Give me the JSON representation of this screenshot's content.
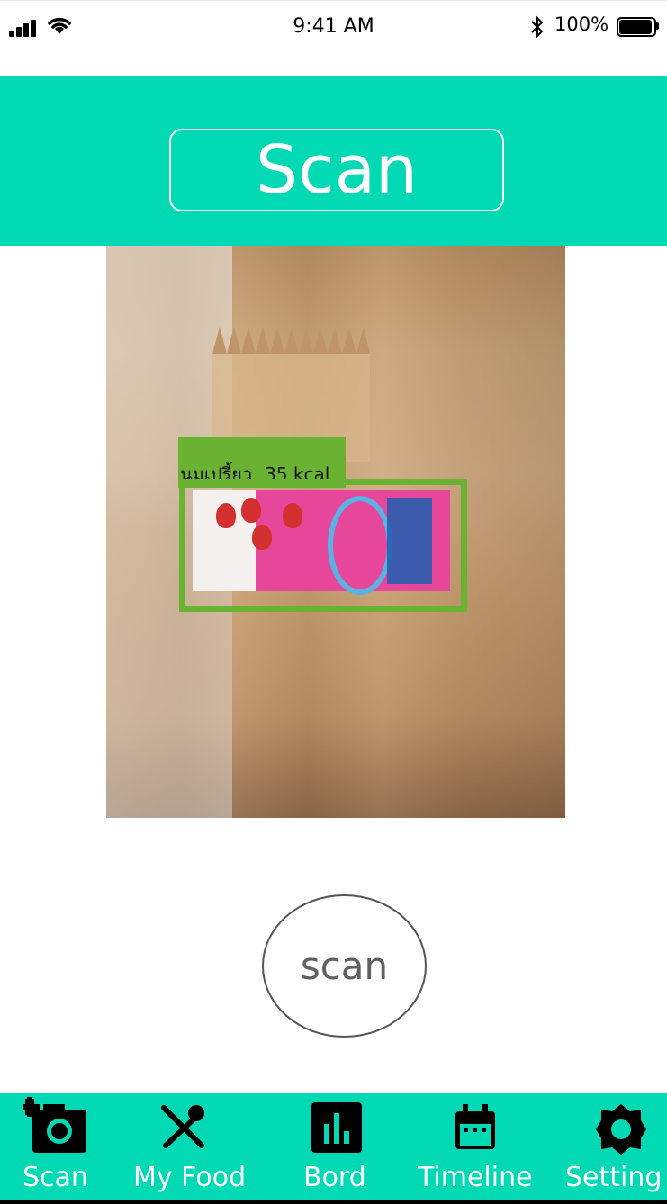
{
  "status_bar": {
    "time": "9:41 AM",
    "battery_percent": "100%",
    "battery_level": 1.0
  },
  "header": {
    "title": "Scan"
  },
  "detection": {
    "food_name": "นมเปรี้ยว",
    "calories": "35 kcal"
  },
  "scan_button": {
    "label": "scan"
  },
  "tabbar": {
    "items": [
      {
        "label": "Scan",
        "icon": "add-camera-icon"
      },
      {
        "label": "My Food",
        "icon": "fork-spoon-icon"
      },
      {
        "label": "Bord",
        "icon": "bar-chart-icon"
      },
      {
        "label": "Timeline",
        "icon": "calendar-icon"
      },
      {
        "label": "Setting",
        "icon": "gear-icon"
      }
    ]
  },
  "colors": {
    "accent": "#00d9b3",
    "detection": "#6ab232"
  }
}
